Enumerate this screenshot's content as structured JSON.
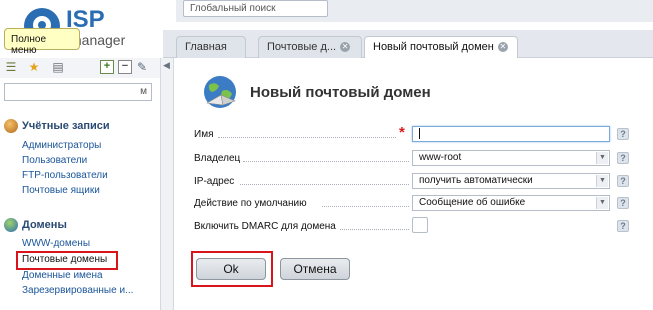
{
  "logo": {
    "brand": "ISP",
    "sub": "manager"
  },
  "search": {
    "placeholder": "Глобальный поиск"
  },
  "tabs": [
    {
      "label": "Главная"
    },
    {
      "label": "Почтовые д..."
    },
    {
      "label": "Новый почтовый домен"
    }
  ],
  "sidebar": {
    "tooltip": "Полное меню",
    "filter_value": "м",
    "sections": [
      {
        "title": "Учётные записи",
        "items": [
          "Администраторы",
          "Пользователи",
          "FTP-пользователи",
          "Почтовые ящики"
        ]
      },
      {
        "title": "Домены",
        "items": [
          "WWW-домены",
          "Почтовые домены",
          "Доменные имена",
          "Зарезервированные и..."
        ]
      }
    ]
  },
  "form": {
    "title": "Новый почтовый домен",
    "fields": [
      {
        "label": "Имя",
        "value": ""
      },
      {
        "label": "Владелец",
        "value": "www-root"
      },
      {
        "label": "IP-адрес",
        "value": "получить автоматически"
      },
      {
        "label": "Действие по умолчанию",
        "value": "Сообщение об ошибке"
      },
      {
        "label": "Включить DMARC для домена",
        "checked": false
      }
    ],
    "help_glyph": "?",
    "required_glyph": "*",
    "ok_label": "Ok",
    "cancel_label": "Отмена"
  },
  "colors": {
    "accent": "#2a6db3",
    "highlight": "#d9141b",
    "link": "#1a5599"
  }
}
